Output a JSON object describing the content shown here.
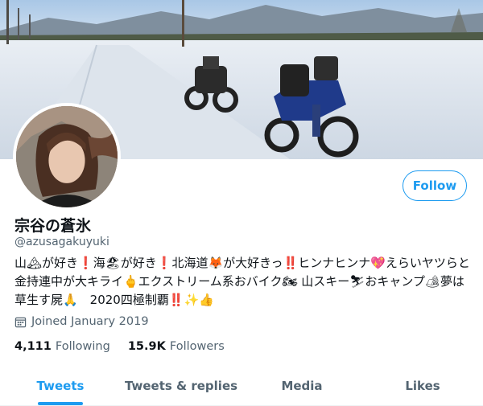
{
  "profile": {
    "display_name": "宗谷の蒼氷",
    "handle": "@azusagakuyuki",
    "bio": "山🏔が好き❗️海🏖が好き❗️北海道🦊が大好きっ‼️ヒンナヒンナ💖えらいヤツらと金持連中が大キライ🖕エクストリーム系おバイク🏍 山スキー⛷おキャンプ🏕夢は草生す屍🙏　2020四極制覇‼️✨👍",
    "joined": "Joined January 2019",
    "follow_label": "Follow"
  },
  "stats": {
    "following_count": "4,111",
    "following_label": "Following",
    "followers_count": "15.9K",
    "followers_label": "Followers"
  },
  "tabs": [
    {
      "label": "Tweets"
    },
    {
      "label": "Tweets & replies"
    },
    {
      "label": "Media"
    },
    {
      "label": "Likes"
    }
  ],
  "colors": {
    "accent": "#1d9bf0",
    "muted": "#536471",
    "text": "#0f1419"
  }
}
